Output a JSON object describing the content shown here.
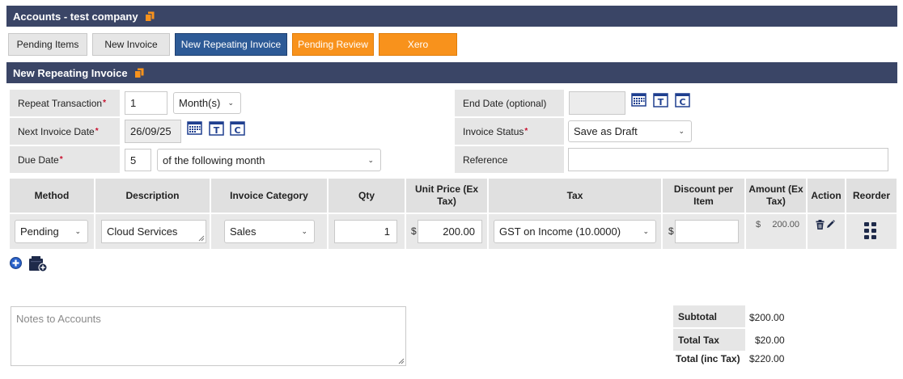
{
  "header": {
    "title": "Accounts - test company"
  },
  "tabs": [
    {
      "label": "Pending Items"
    },
    {
      "label": "New Invoice"
    },
    {
      "label": "New Repeating Invoice"
    },
    {
      "label": "Pending Review"
    },
    {
      "label": "Xero"
    }
  ],
  "section": {
    "title": "New Repeating Invoice"
  },
  "form": {
    "repeat_label": "Repeat Transaction",
    "repeat_value": "1",
    "repeat_unit": "Month(s)",
    "next_label": "Next Invoice Date",
    "next_value": "26/09/25",
    "due_label": "Due Date",
    "due_value": "5",
    "due_option": "of the following month",
    "end_label": "End Date (optional)",
    "end_value": "",
    "status_label": "Invoice Status",
    "status_value": "Save as Draft",
    "reference_label": "Reference",
    "reference_value": "",
    "required_mark": "*",
    "cal_t": "T",
    "cal_c": "C"
  },
  "table": {
    "headers": {
      "method": "Method",
      "description": "Description",
      "category": "Invoice Category",
      "qty": "Qty",
      "unit_price": "Unit Price (Ex Tax)",
      "tax": "Tax",
      "discount": "Discount per Item",
      "amount": "Amount (Ex Tax)",
      "action": "Action",
      "reorder": "Reorder"
    },
    "rows": [
      {
        "method": "Pending",
        "description": "Cloud Services",
        "category": "Sales",
        "qty": "1",
        "currency": "$",
        "unit_price": "200.00",
        "tax": "GST on Income (10.0000)",
        "discount": "",
        "amount": "200.00"
      }
    ]
  },
  "notes": {
    "placeholder": "Notes to Accounts"
  },
  "totals": {
    "subtotal_label": "Subtotal",
    "subtotal_value": "$200.00",
    "tax_label": "Total Tax",
    "tax_value": "$20.00",
    "total_label": "Total (inc Tax)",
    "total_value": "$220.00"
  },
  "colors": {
    "header_bar": "#3a4566",
    "active_tab": "#2d5a96",
    "orange_tab": "#f8921c",
    "icon_blue": "#1f3f8f"
  }
}
